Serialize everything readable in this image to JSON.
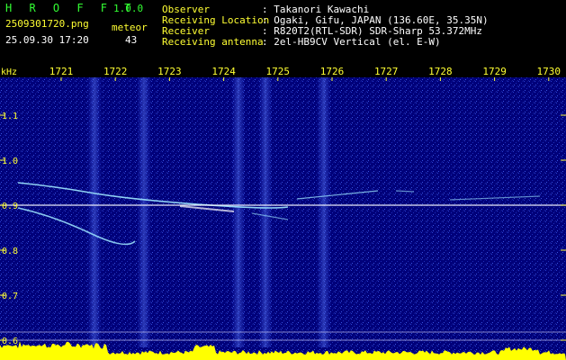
{
  "header": {
    "app_name": "H R O F F T",
    "version": "1.0.0",
    "filename": "2509301720.png",
    "datetime": "25.09.30 17:20",
    "meteor_label": "meteor",
    "meteor_count": "43",
    "info": [
      {
        "label": "Observer",
        "value": ": Takanori Kawachi"
      },
      {
        "label": "Receiving Location",
        "value": ": Ogaki, Gifu, JAPAN (136.60E, 35.35N)"
      },
      {
        "label": "Receiver",
        "value": ": R820T2(RTL-SDR) SDR-Sharp 53.372MHz"
      },
      {
        "label": "Receiving antenna",
        "value": ": 2el-HB9CV Vertical (el. E-W)"
      }
    ]
  },
  "chart_data": {
    "type": "heatmap",
    "ylabel": "kHz",
    "x_ticks": [
      "1721",
      "1722",
      "1723",
      "1724",
      "1725",
      "1726",
      "1727",
      "1728",
      "1729",
      "1730"
    ],
    "y_ticks": [
      "1.1",
      "1.0",
      "0.9",
      "0.8",
      "0.7",
      "0.6"
    ],
    "ylim": [
      0.58,
      1.18
    ],
    "carrier_khz": 0.9,
    "colors": {
      "background": "#000080",
      "text": "#ffff33",
      "signal": "#ffffff",
      "level": "#ffff00"
    }
  }
}
